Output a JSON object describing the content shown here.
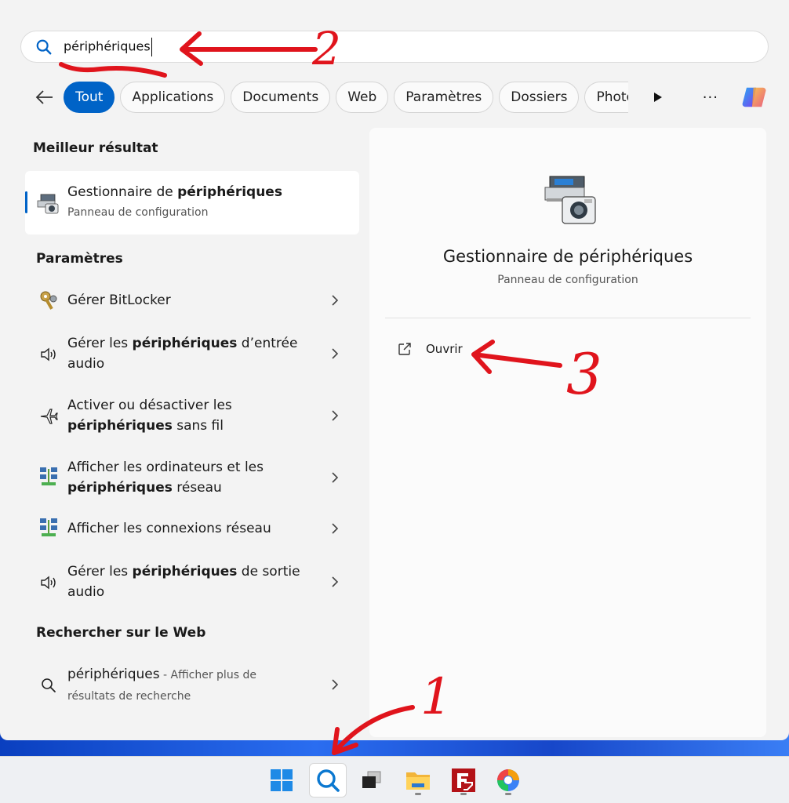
{
  "search": {
    "query": "périphériques"
  },
  "filters": [
    {
      "label": "Tout",
      "active": true
    },
    {
      "label": "Applications"
    },
    {
      "label": "Documents"
    },
    {
      "label": "Web"
    },
    {
      "label": "Paramètres"
    },
    {
      "label": "Dossiers"
    },
    {
      "label": "Photos"
    }
  ],
  "more_label": "···",
  "sections": {
    "best": "Meilleur résultat",
    "settings": "Paramètres",
    "web": "Rechercher sur le Web"
  },
  "best_result": {
    "title_prefix": "Gestionnaire de ",
    "title_bold": "périphériques",
    "subtitle": "Panneau de configuration"
  },
  "settings_items": [
    {
      "pre": "Gérer BitLocker",
      "bold": "",
      "post": "",
      "icon": "bitlocker-keys-icon"
    },
    {
      "pre": "Gérer les ",
      "bold": "périphériques",
      "post": " d’entrée audio",
      "icon": "speaker-icon"
    },
    {
      "pre": "Activer ou désactiver les ",
      "bold": "périphériques",
      "post": " sans fil",
      "icon": "airplane-icon"
    },
    {
      "pre": "Afficher les ordinateurs et les ",
      "bold": "périphériques",
      "post": " réseau",
      "icon": "network-icon"
    },
    {
      "pre": "Afficher les connexions réseau",
      "bold": "",
      "post": "",
      "icon": "network-icon"
    },
    {
      "pre": "Gérer les ",
      "bold": "périphériques",
      "post": " de sortie audio",
      "icon": "speaker-icon"
    }
  ],
  "web_item": {
    "query": "périphériques",
    "suffix": " - Afficher plus de résultats de recherche"
  },
  "preview": {
    "title": "Gestionnaire de périphériques",
    "subtitle": "Panneau de configuration",
    "open_label": "Ouvrir"
  },
  "annotations": [
    "1",
    "2",
    "3"
  ],
  "colors": {
    "accent": "#0063c7",
    "annotation": "#e0141c"
  }
}
